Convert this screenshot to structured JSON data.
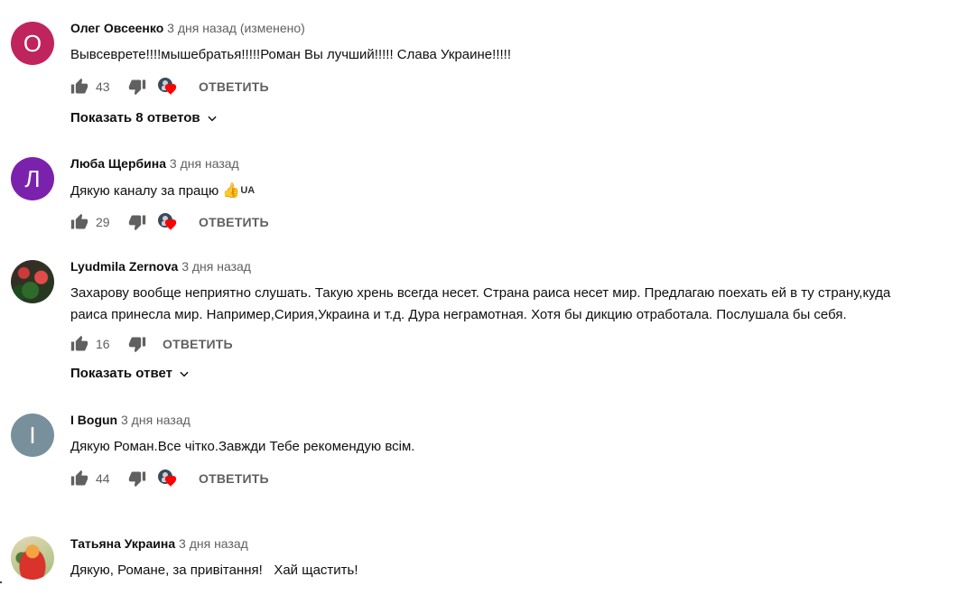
{
  "comments": [
    {
      "avatar_letter": "О",
      "avatar_color": "#c0245c",
      "author": "Олег Овсеенко",
      "time": "3 дня назад (изменено)",
      "text": "Вывсеврете!!!!мышебратья!!!!!Роман Вы лучший!!!!! Слава Украине!!!!!",
      "likes": "43",
      "reply_label": "ОТВЕТИТЬ",
      "replies_label": "Показать 8 ответов"
    },
    {
      "avatar_letter": "Л",
      "avatar_color": "#7b22ad",
      "author": "Люба Щербина",
      "time": "3 дня назад",
      "text": "Дякую каналу за працю",
      "text_emoji": "👍",
      "text_suffix": "UA",
      "likes": "29",
      "reply_label": "ОТВЕТИТЬ"
    },
    {
      "author": "Lyudmila Zernova",
      "time": "3 дня назад",
      "text_line1": "Захарову вообще неприятно слушать. Такую хрень всегда несет. Страна раиса несет мир. Предлагаю поехать ей в ту страну,куда",
      "text_line2": "раиса принесла мир. Например,Сирия,Украина и т.д. Дура неграмотная. Хотя бы дикцию отработала. Послушала бы себя.",
      "likes": "16",
      "reply_label": "ОТВЕТИТЬ",
      "replies_label": "Показать ответ"
    },
    {
      "avatar_letter": "I",
      "avatar_color": "#78909c",
      "author": "I Bogun",
      "time": "3 дня назад",
      "text": "Дякую Роман.Все чітко.Завжди Тебе рекомендую всім.",
      "likes": "44",
      "reply_label": "ОТВЕТИТЬ"
    },
    {
      "author": "Татьяна Украина",
      "time": "3 дня назад",
      "text": "Дякую, Романе, за привітання!   Хай щастить!"
    }
  ],
  "colors": {
    "heart": "#ff0000",
    "icon": "#606060"
  },
  "icons": [
    "thumb-up-icon",
    "thumb-down-icon",
    "creator-heart-icon",
    "chevron-down-icon"
  ]
}
